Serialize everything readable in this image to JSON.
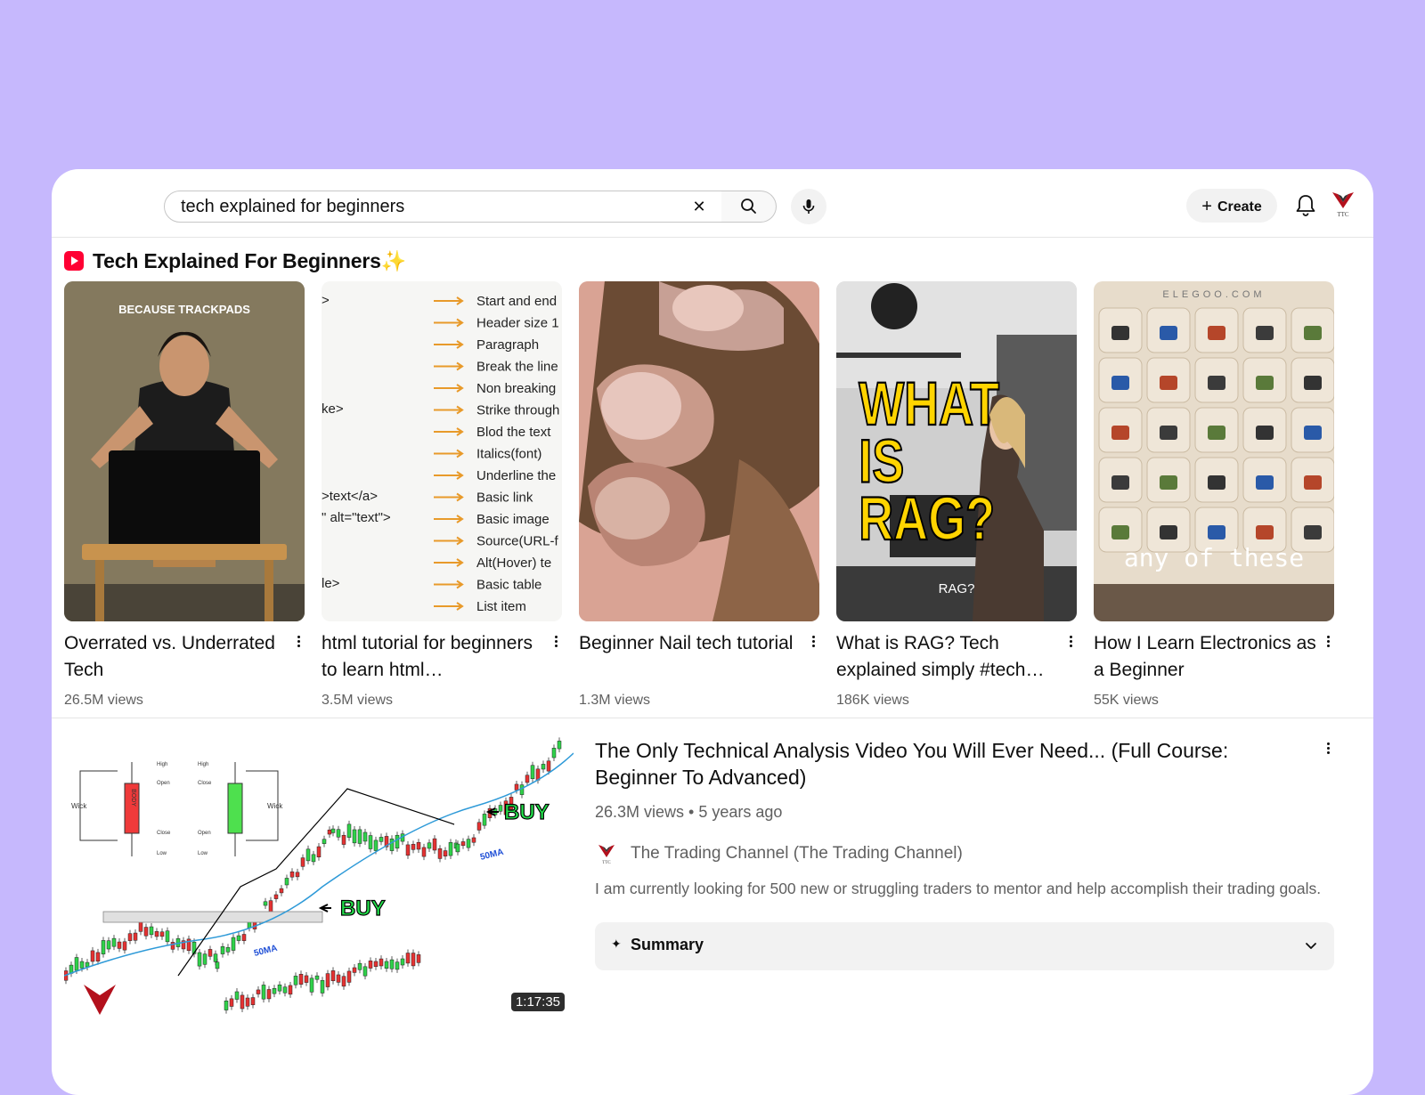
{
  "search": {
    "query": "tech explained for beginners",
    "clear_icon": "close-icon",
    "search_icon": "search-icon",
    "mic_icon": "mic-icon"
  },
  "header": {
    "create_label": "Create",
    "notifications_icon": "bell-icon",
    "avatar_text": "TTC"
  },
  "shorts": {
    "title": "Tech Explained For Beginners✨",
    "items": [
      {
        "title": "Overrated vs. Underrated Tech",
        "views": "26.5M views",
        "overlay": "BECAUSE TRACKPADS"
      },
      {
        "title": "html tutorial for beginners to learn html…",
        "views": "3.5M views",
        "code_lines": [
          ">",
          "",
          "",
          "",
          "",
          "ke>",
          "",
          "",
          "",
          ">text</a>",
          "\" alt=\"text\">",
          "",
          "",
          "le>",
          ""
        ],
        "arrow_lines": [
          "Start and end",
          "Header size 1",
          "Paragraph",
          "Break the line",
          "Non breaking",
          "Strike through",
          "Blod the text",
          "Italics(font)",
          "Underline the",
          "Basic link",
          "Basic image",
          "Source(URL-f",
          "Alt(Hover) te",
          "Basic table",
          "List item"
        ]
      },
      {
        "title": "Beginner Nail tech tutorial",
        "views": "1.3M views"
      },
      {
        "title": "What is RAG? Tech explained simply #tech…",
        "views": "186K views",
        "overlay_1": "WHAT",
        "overlay_2": "IS",
        "overlay_3": "RAG?",
        "caption": "RAG?"
      },
      {
        "title": "How I Learn Electronics as a Beginner",
        "views": "55K views",
        "brand": "ELEGOO.COM",
        "caption": "any of these"
      }
    ]
  },
  "video": {
    "title": "The Only Technical Analysis Video You Will Ever Need... (Full Course: Beginner To Advanced)",
    "meta": "26.3M views • 5 years ago",
    "channel": "The Trading Channel (The Trading Channel)",
    "description": "I am currently looking for 500 new or struggling traders to mentor and help accomplish their trading goals.",
    "summary_label": "Summary",
    "duration": "1:17:35",
    "thumb_labels": {
      "buy_1": "BUY",
      "buy_2": "BUY",
      "ma_1": "50MA",
      "ma_2": "50MA",
      "wick_left": "Wick",
      "wick_right": "Wick",
      "body": "BODY",
      "high": "High",
      "open": "Open",
      "close": "Close",
      "low": "Low"
    }
  },
  "colors": {
    "background": "#c6b8fd",
    "shorts_red": "#ff0033",
    "buy_green": "#22e04b"
  }
}
